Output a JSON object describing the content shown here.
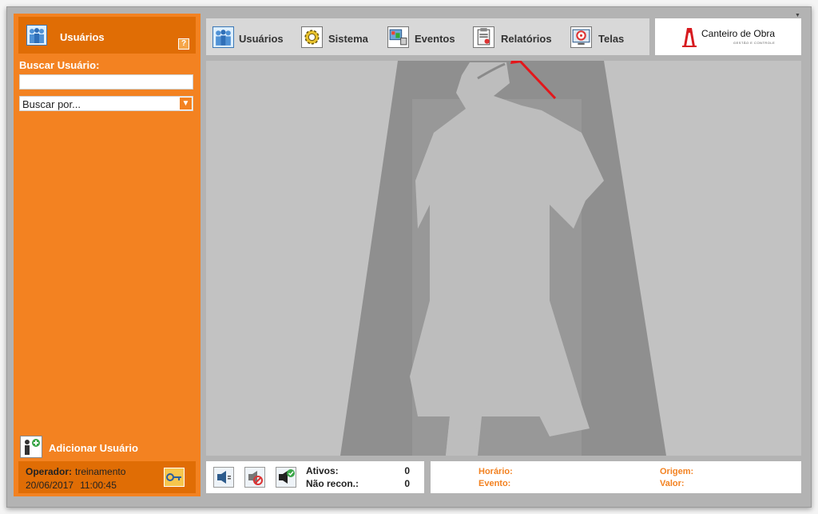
{
  "sidebar": {
    "title": "Usuários",
    "help_label": "?",
    "search_label": "Buscar Usuário:",
    "search_value": "",
    "search_by": "Buscar por...",
    "add_user_label": "Adicionar Usuário",
    "operator_label": "Operador:",
    "operator_name": "treinamento",
    "date": "20/06/2017",
    "time": "11:00:45"
  },
  "toolbar": {
    "items": [
      {
        "label": "Usuários",
        "icon": "users-icon"
      },
      {
        "label": "Sistema",
        "icon": "gear-icon"
      },
      {
        "label": "Eventos",
        "icon": "events-icon"
      },
      {
        "label": "Relatórios",
        "icon": "reports-icon"
      },
      {
        "label": "Telas",
        "icon": "screens-icon"
      }
    ]
  },
  "logo": {
    "name": "Canteiro de Obra",
    "tagline": "GESTÃO E CONTROLE"
  },
  "status": {
    "ativos_label": "Ativos:",
    "ativos_value": "0",
    "nao_recon_label": "Não recon.:",
    "nao_recon_value": "0",
    "horario_label": "Horário:",
    "evento_label": "Evento:",
    "origem_label": "Origem:",
    "valor_label": "Valor:"
  },
  "colors": {
    "accent": "#f38221",
    "accent_dark": "#e06d05",
    "annotation_arrow": "#e3171b"
  }
}
